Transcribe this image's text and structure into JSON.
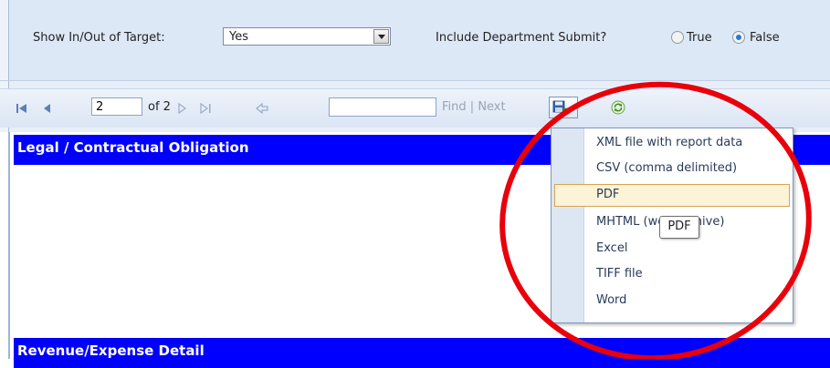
{
  "parameters": {
    "target_label": "Show In/Out of Target:",
    "target_value": "Yes",
    "dept_label": "Include Department Submit?",
    "true_label": "True",
    "false_label": "False"
  },
  "toolbar": {
    "page_value": "2",
    "of_label": "of 2",
    "find_label": "Find",
    "separator": "|",
    "next_label": "Next"
  },
  "report": {
    "section1_title": "Legal / Contractual Obligation",
    "section2_title": "Revenue/Expense Detail"
  },
  "export_menu": {
    "items": [
      "XML file with report data",
      "CSV (comma delimited)",
      "PDF",
      "MHTML (web archive)",
      "Excel",
      "TIFF file",
      "Word"
    ],
    "tooltip": "PDF"
  },
  "colors": {
    "section_header": "#0000ff",
    "annotation": "#e8000b",
    "panel_bg": "#dde8f7"
  }
}
